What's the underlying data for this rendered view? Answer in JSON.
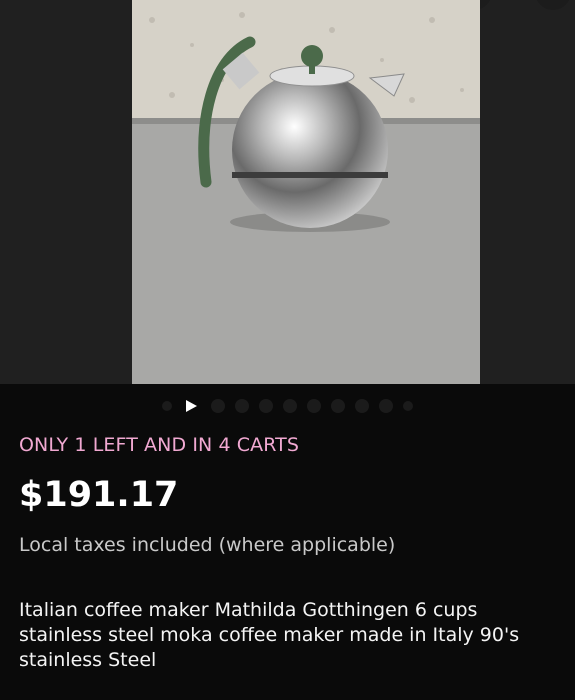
{
  "listing": {
    "stock_notice": "ONLY 1 LEFT AND IN 4 CARTS",
    "price": "$191.17",
    "tax_note": "Local taxes included (where applicable)",
    "title": "Italian coffee maker Mathilda Gotthingen 6 cups stainless steel moka coffee maker made in Italy 90's stainless Steel"
  },
  "gallery": {
    "photo_subject": "chrome kettle with green handle",
    "video_icon": "play-icon",
    "indicator_count": 11,
    "active_indicator": 0
  },
  "colors": {
    "background": "#0a0a0a",
    "stock_notice": "#f1a9d2",
    "price": "#ffffff"
  }
}
